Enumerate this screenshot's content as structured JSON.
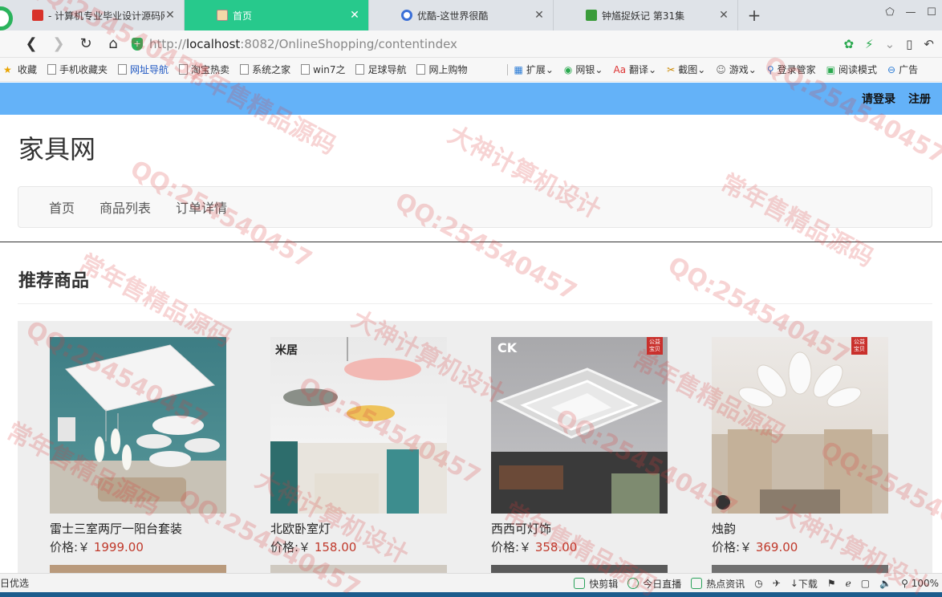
{
  "browser": {
    "tabs": [
      {
        "title": "- 计算机专业毕业设计源码网",
        "active": false,
        "icon": "red-square-icon"
      },
      {
        "title": "首页",
        "active": true,
        "icon": "page-icon"
      },
      {
        "title": "优酷-这世界很酷",
        "active": false,
        "icon": "youku-icon"
      },
      {
        "title": "钟馗捉妖记 第31集",
        "active": false,
        "icon": "video-icon"
      }
    ],
    "new_tab": "+",
    "url_scheme": "http://",
    "url_host": "localhost",
    "url_rest": ":8082/OnlineShopping/contentindex",
    "bookmarks": [
      "收藏",
      "手机收藏夹",
      "网址导航",
      "淘宝热卖",
      "系统之家",
      "win7之",
      "足球导航",
      "网上购物"
    ],
    "tools": [
      "扩展",
      "网银",
      "翻译",
      "截图",
      "游戏",
      "登录管家",
      "阅读模式",
      "广告"
    ]
  },
  "site": {
    "top_links": {
      "login": "请登录",
      "register": "注册"
    },
    "brand": "家具网",
    "nav": [
      "首页",
      "商品列表",
      "订单详情"
    ],
    "section_title": "推荐商品",
    "price_prefix": "价格:￥",
    "products": [
      {
        "name": "雷士三室两厅一阳台套装",
        "price": "1999.00"
      },
      {
        "name": "北欧卧室灯",
        "price": "158.00",
        "label": "米居"
      },
      {
        "name": "西西可灯饰",
        "price": "358.00",
        "label": "CK",
        "badge": "公益宝贝"
      },
      {
        "name": "烛韵",
        "price": "369.00",
        "badge": "公益宝贝"
      }
    ]
  },
  "statusbar": {
    "left": "日优选",
    "items": [
      "快剪辑",
      "今日直播",
      "热点资讯",
      "下载"
    ],
    "zoom": "100%"
  },
  "watermark": [
    "QQ:254540457",
    "常年售精品源码",
    "大神计算机设计"
  ]
}
